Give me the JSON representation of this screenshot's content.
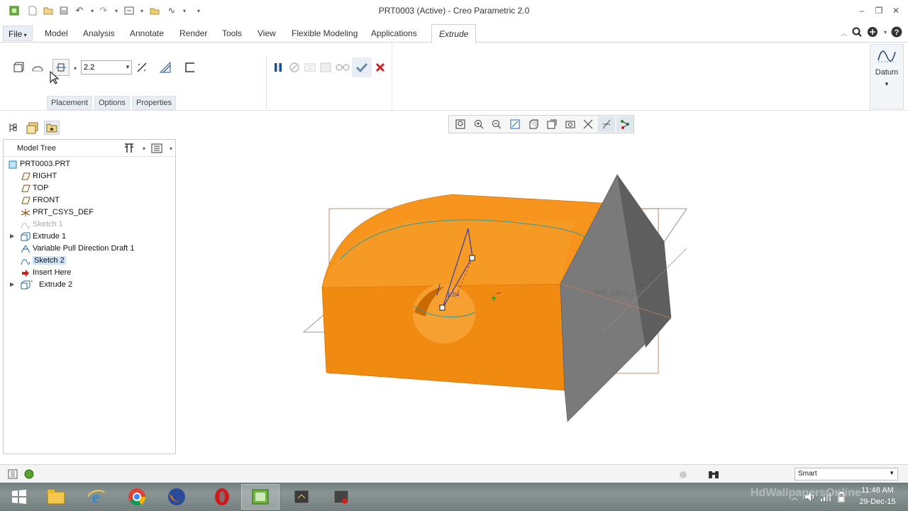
{
  "window": {
    "title": "PRT0003 (Active) - Creo Parametric 2.0"
  },
  "menu": {
    "file_label": "File",
    "tabs": [
      {
        "label": "Model"
      },
      {
        "label": "Analysis"
      },
      {
        "label": "Annotate"
      },
      {
        "label": "Render"
      },
      {
        "label": "Tools"
      },
      {
        "label": "View"
      },
      {
        "label": "Flexible Modeling"
      },
      {
        "label": "Applications"
      },
      {
        "label": "Extrude"
      }
    ]
  },
  "extrude": {
    "depth_value": "2.2",
    "subtabs": [
      {
        "label": "Placement"
      },
      {
        "label": "Options"
      },
      {
        "label": "Properties"
      }
    ],
    "datum_label": "Datum"
  },
  "model_tree": {
    "title": "Model Tree",
    "nodes": [
      {
        "label": "PRT0003.PRT",
        "icon": "part-icon"
      },
      {
        "label": "RIGHT",
        "icon": "datum-plane-icon"
      },
      {
        "label": "TOP",
        "icon": "datum-plane-icon"
      },
      {
        "label": "FRONT",
        "icon": "datum-plane-icon"
      },
      {
        "label": "PRT_CSYS_DEF",
        "icon": "csys-icon"
      },
      {
        "label": "Sketch 1",
        "icon": "sketch-icon",
        "state": "hidden"
      },
      {
        "label": "Extrude 1",
        "icon": "extrude-icon"
      },
      {
        "label": "Variable Pull Direction Draft 1",
        "icon": "draft-icon"
      },
      {
        "label": "Sketch 2",
        "icon": "sketch-icon",
        "state": "selected"
      },
      {
        "label": "Insert Here",
        "icon": "insert-arrow-icon"
      },
      {
        "label": "Extrude 2",
        "icon": "extrude-icon"
      }
    ]
  },
  "viewport": {
    "dimension_label": "1.04",
    "csys_label": "PRT_CSYS_DEF"
  },
  "status": {
    "filter_value": "Smart"
  },
  "taskbar": {
    "time": "11:48 AM",
    "date": "29-Dec-15",
    "watermark": "HdWallpapersOnline"
  },
  "colors": {
    "part_orange": "#f7941d",
    "part_grey": "#7a7a7a",
    "cancel_red": "#cc2222",
    "confirm_blue": "#6a8aa8"
  }
}
